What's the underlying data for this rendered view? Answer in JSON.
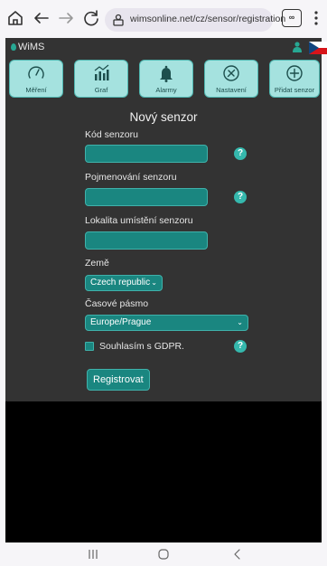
{
  "browser": {
    "url": "wimsonline.net/cz/sensor/registration",
    "tab_count": "∞",
    "icons": [
      "home-icon",
      "back-icon",
      "forward-icon",
      "reload-icon",
      "site-info-icon",
      "tabs-icon",
      "menu-icon"
    ]
  },
  "app": {
    "logo_text": "WiMS",
    "nav": [
      {
        "label": "Měření",
        "icon": "gauge-icon"
      },
      {
        "label": "Graf",
        "icon": "chart-icon"
      },
      {
        "label": "Alarmy",
        "icon": "bell-icon"
      },
      {
        "label": "Nastavení",
        "icon": "settings-icon"
      },
      {
        "label": "Přidat senzor",
        "icon": "plus-circle-icon"
      }
    ]
  },
  "form": {
    "title": "Nový senzor",
    "sensor_code_label": "Kód senzoru",
    "sensor_code_value": "",
    "sensor_name_label": "Pojmenování senzoru",
    "sensor_name_value": "",
    "location_label": "Lokalita umístění senzoru",
    "location_value": "",
    "country_label": "Země",
    "country_value": "Czech republic",
    "timezone_label": "Časové pásmo",
    "timezone_value": "Europe/Prague",
    "gdpr_label": "Souhlasím s GDPR.",
    "gdpr_checked": false,
    "help_text": "?",
    "submit_label": "Registrovat"
  },
  "colors": {
    "accent": "#1a8680",
    "nav_button": "#a5e2df",
    "background": "#333333",
    "help": "#35b8ad"
  }
}
